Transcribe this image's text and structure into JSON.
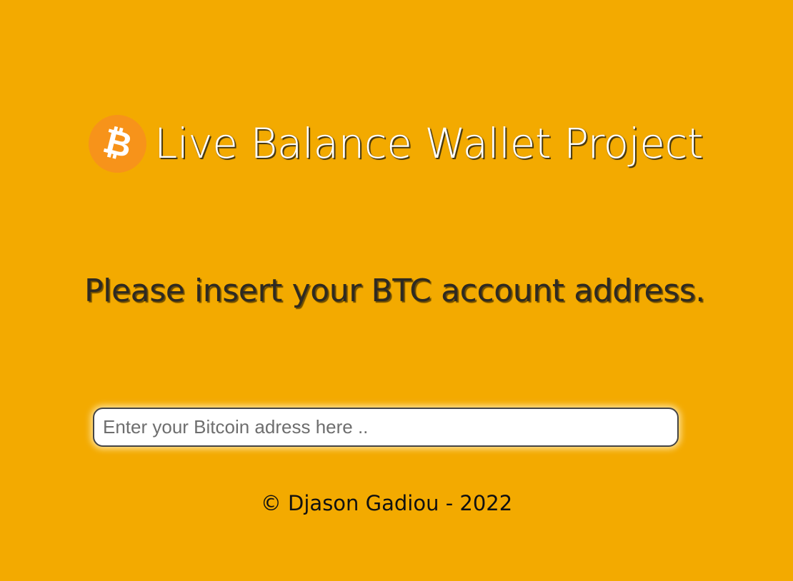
{
  "app": {
    "title": "Live Balance Wallet Project",
    "logo_icon": "bitcoin-logo-icon",
    "logo_glyph": "₿"
  },
  "prompt": {
    "text": "Please insert your BTC account address."
  },
  "address_input": {
    "value": "",
    "placeholder": "Enter your Bitcoin adress here .."
  },
  "footer": {
    "copyright": "© Djason Gadiou - 2022"
  },
  "colors": {
    "background": "#f3aa00",
    "logo_circle": "#f7931a",
    "title_text": "#ffffff",
    "prompt_text": "#2e2a22",
    "input_border": "#444444"
  }
}
